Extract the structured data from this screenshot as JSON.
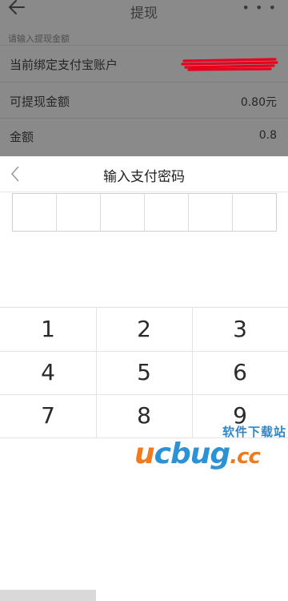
{
  "header": {
    "title": "提现"
  },
  "form": {
    "hint": "请输入提现金额",
    "rows": [
      {
        "label": "当前绑定支付宝账户",
        "value": ""
      },
      {
        "label": "可提现金额",
        "value": "0.80元"
      },
      {
        "label": "金额",
        "value": "0.8"
      }
    ]
  },
  "password_sheet": {
    "title": "输入支付密码",
    "pin_length": 6
  },
  "keypad": {
    "keys": [
      "1",
      "2",
      "3",
      "4",
      "5",
      "6",
      "7",
      "8",
      "9"
    ]
  },
  "watermark": {
    "tagline": "软件下载站",
    "brand_u": "u",
    "brand_c": "c",
    "brand_bug": "bug",
    "brand_tld": ".cc"
  },
  "colors": {
    "overlay_bg": "#8a8a8a",
    "redaction": "#e8001c",
    "watermark_orange": "#f07a1d",
    "watermark_blue": "#2c92d6"
  }
}
